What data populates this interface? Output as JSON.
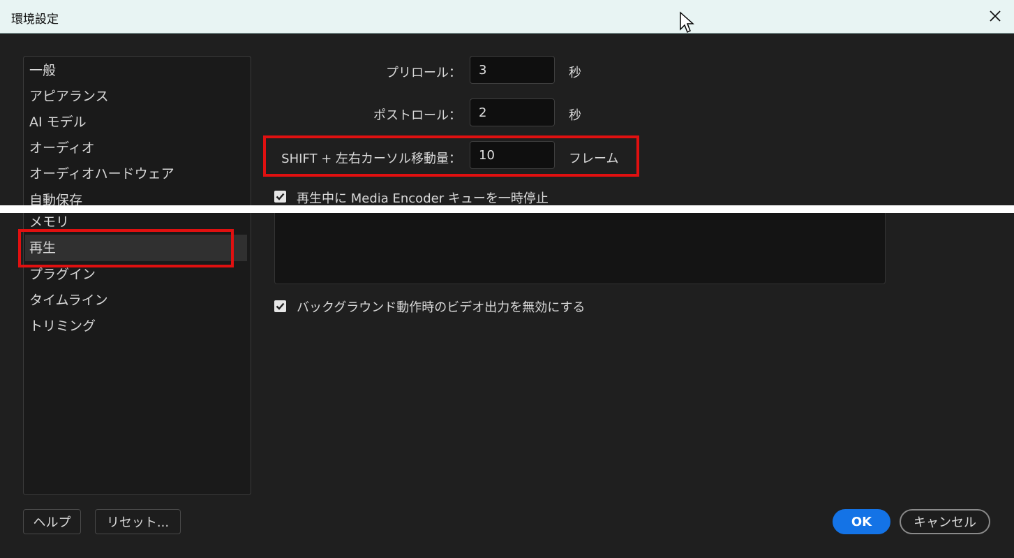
{
  "window": {
    "title": "環境設定"
  },
  "sidebar": {
    "items": [
      {
        "label": "一般"
      },
      {
        "label": "アピアランス"
      },
      {
        "label": "AI モデル"
      },
      {
        "label": "オーディオ"
      },
      {
        "label": "オーディオハードウェア"
      },
      {
        "label": "自動保存"
      },
      {
        "label": "メモリ"
      },
      {
        "label": "再生"
      },
      {
        "label": "プラグイン"
      },
      {
        "label": "タイムライン"
      },
      {
        "label": "トリミング"
      }
    ],
    "selected": "再生"
  },
  "playback": {
    "preroll": {
      "label": "プリロール：",
      "value": "3",
      "unit": "秒"
    },
    "postroll": {
      "label": "ポストロール：",
      "value": "2",
      "unit": "秒"
    },
    "shift_step": {
      "label": "SHIFT + 左右カーソル移動量：",
      "value": "10",
      "unit": "フレーム"
    },
    "pause_media_encoder": {
      "label": "再生中に Media Encoder キューを一時停止",
      "checked": true
    },
    "disable_video_output": {
      "label": "バックグラウンド動作時のビデオ出力を無効にする",
      "checked": true
    }
  },
  "footer": {
    "help_label": "ヘルプ",
    "reset_label": "リセット...",
    "ok_label": "OK",
    "cancel_label": "キャンセル"
  },
  "colors": {
    "accent": "#1473e6",
    "highlight": "#e01010",
    "background": "#1f1f1f"
  }
}
